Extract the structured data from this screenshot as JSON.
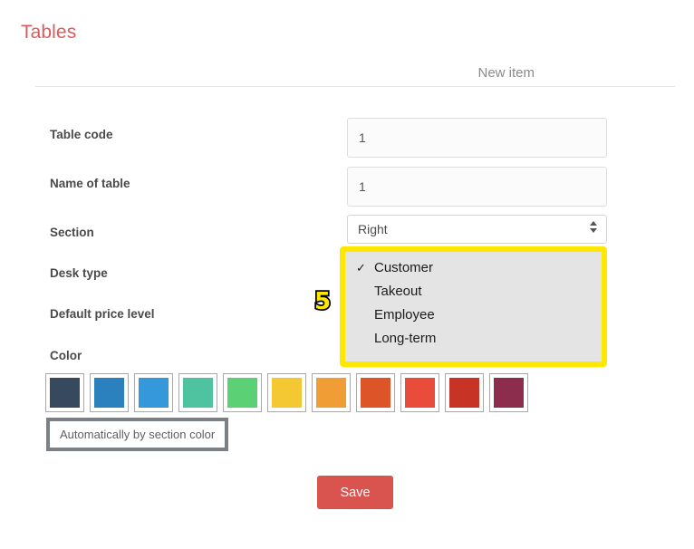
{
  "page": {
    "title": "Tables",
    "title_color": "#dd5a5a"
  },
  "form_header": {
    "title": "New item"
  },
  "fields": {
    "table_code": {
      "label": "Table code",
      "value": "1",
      "placeholder": ""
    },
    "name_of_table": {
      "label": "Name of table",
      "value": "1",
      "placeholder": ""
    },
    "section": {
      "label": "Section",
      "value": "Right",
      "options": [
        "Right"
      ]
    },
    "desk_type": {
      "label": "Desk type",
      "value": "Customer",
      "options": [
        "Customer",
        "Takeout",
        "Employee",
        "Long-term"
      ],
      "selected_index": 0,
      "expanded": true
    },
    "default_price_level": {
      "label": "Default price level",
      "value": ""
    },
    "color": {
      "label": "Color"
    }
  },
  "dropdown": {
    "check_glyph": "✓",
    "options": [
      {
        "label": "Customer",
        "checked": true
      },
      {
        "label": "Takeout",
        "checked": false
      },
      {
        "label": "Employee",
        "checked": false
      },
      {
        "label": "Long-term",
        "checked": false
      }
    ]
  },
  "annotation": {
    "badge": "5",
    "highlight_color": "#ffe800",
    "badge_fill": "#ffe800",
    "badge_stroke": "#000000"
  },
  "color_swatches": [
    {
      "name": "dark-navy",
      "hex": "#37495e"
    },
    {
      "name": "blue",
      "hex": "#2b81bd"
    },
    {
      "name": "light-blue",
      "hex": "#3598db"
    },
    {
      "name": "teal-green",
      "hex": "#4fc39f"
    },
    {
      "name": "green",
      "hex": "#5cd075"
    },
    {
      "name": "yellow",
      "hex": "#f3c832"
    },
    {
      "name": "orange",
      "hex": "#f09d35"
    },
    {
      "name": "dark-orange",
      "hex": "#dc5428"
    },
    {
      "name": "red",
      "hex": "#ea4c3c"
    },
    {
      "name": "dark-red",
      "hex": "#c73425"
    },
    {
      "name": "maroon",
      "hex": "#8d2d4e"
    }
  ],
  "auto_color_button": {
    "label": "Automatically by section color",
    "outline_color": "#7b7f86"
  },
  "save_button": {
    "label": "Save",
    "color": "#d9534f"
  }
}
